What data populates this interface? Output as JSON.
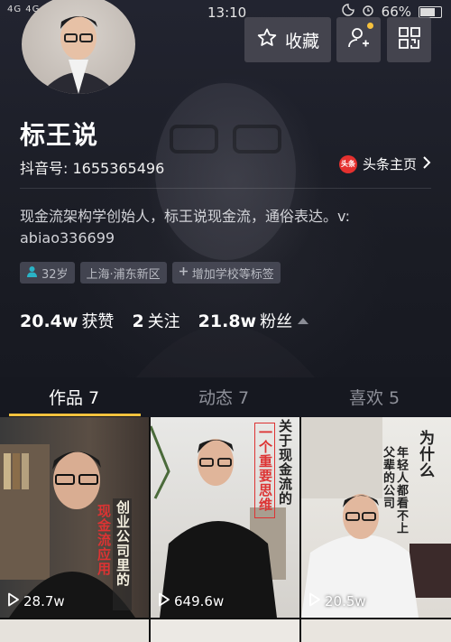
{
  "status": {
    "network": "4G 4G 2G",
    "time": "13:10",
    "battery": "66%",
    "battery_level": 0.66
  },
  "header": {
    "favorite_label": "收藏",
    "add_friend_has_dot": true
  },
  "profile": {
    "name": "标王说",
    "douyin_id": "抖音号: 1655365496",
    "toutiao_badge": "头条",
    "toutiao_label": "头条主页",
    "bio": "现金流架构学创始人，标王说现金流，通俗表达。v: abiao336699",
    "tags": {
      "age": "32岁",
      "location": "上海·浦东新区",
      "add_tags": "增加学校等标签"
    }
  },
  "stats": {
    "likes_value": "20.4w",
    "likes_label": "获赞",
    "following_value": "2",
    "following_label": "关注",
    "fans_value": "21.8w",
    "fans_label": "粉丝"
  },
  "tabs": {
    "works": "作品 7",
    "dynamics": "动态 7",
    "likes": "喜欢 5"
  },
  "videos": [
    {
      "views": "28.7w",
      "overlay_text_1": "创业公司里的",
      "overlay_text_2": "现金流应用"
    },
    {
      "views": "649.6w",
      "overlay_text_1": "关于现金流的",
      "overlay_text_2": "一个重要思维"
    },
    {
      "views": "20.5w",
      "overlay_text_1": "为什么",
      "overlay_text_2": "年轻人都看不上父辈的公司"
    }
  ],
  "colors": {
    "accent": "#f7c23d",
    "background": "#16181f",
    "toutiao": "#e5312f"
  }
}
